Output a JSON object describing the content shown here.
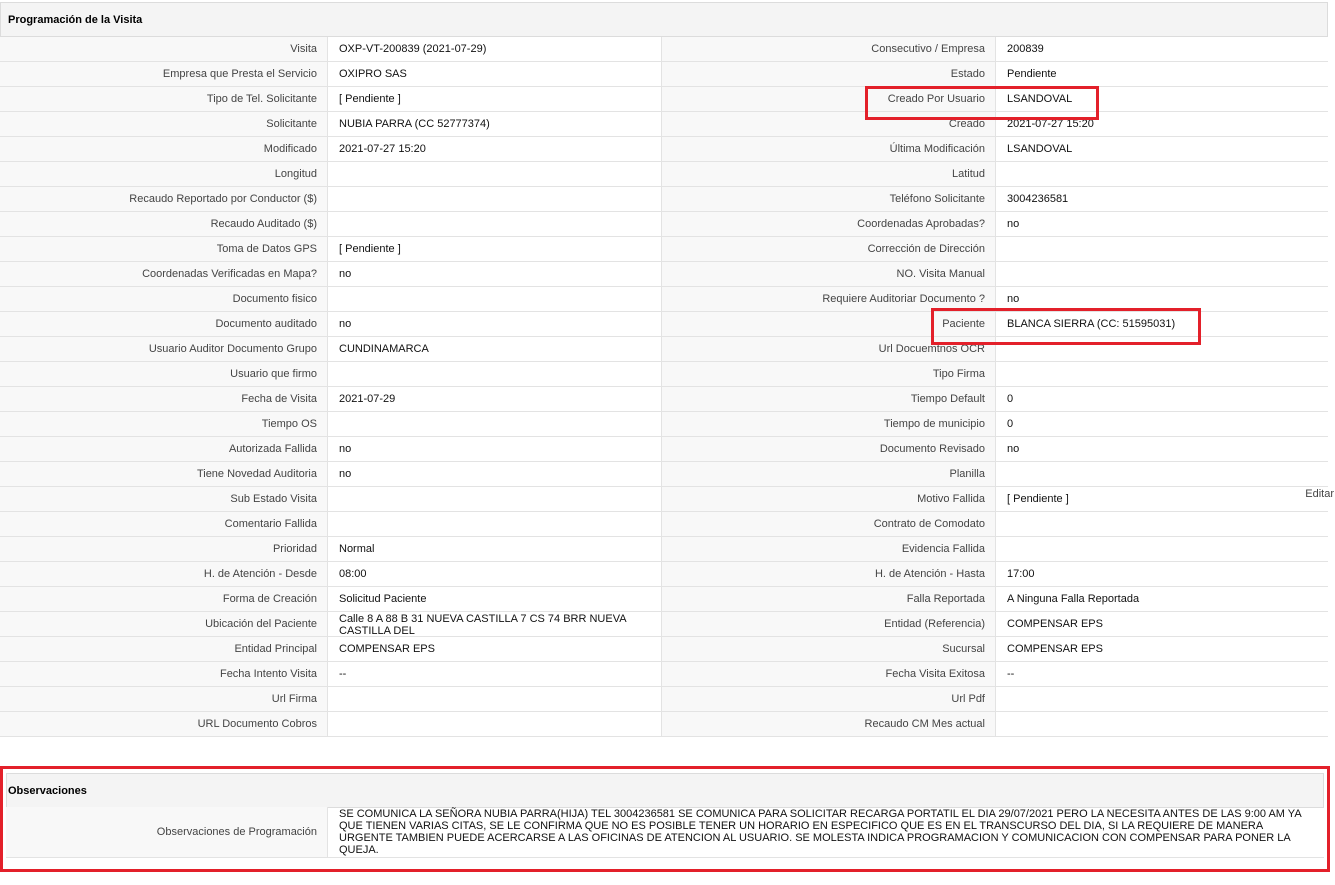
{
  "section_title": "Programación de la Visita",
  "rows": [
    {
      "l1": "Visita",
      "v1": "OXP-VT-200839 (2021-07-29)",
      "l2": "Consecutivo / Empresa",
      "v2": "200839"
    },
    {
      "l1": "Empresa que Presta el Servicio",
      "v1": "OXIPRO SAS",
      "l2": "Estado",
      "v2": "Pendiente"
    },
    {
      "l1": "Tipo de Tel. Solicitante",
      "v1": "[ Pendiente ]",
      "l2": "Creado Por Usuario",
      "v2": "LSANDOVAL"
    },
    {
      "l1": "Solicitante",
      "v1": "NUBIA PARRA (CC 52777374)",
      "l2": "Creado",
      "v2": "2021-07-27 15:20"
    },
    {
      "l1": "Modificado",
      "v1": "2021-07-27 15:20",
      "l2": "Última Modificación",
      "v2": " LSANDOVAL"
    },
    {
      "l1": "Longitud",
      "v1": "",
      "l2": "Latitud",
      "v2": ""
    },
    {
      "l1": "Recaudo Reportado por Conductor ($)",
      "v1": "",
      "l2": "Teléfono Solicitante",
      "v2": "3004236581"
    },
    {
      "l1": "Recaudo Auditado ($)",
      "v1": "",
      "l2": "Coordenadas Aprobadas?",
      "v2": " no"
    },
    {
      "l1": "Toma de Datos GPS",
      "v1": "[ Pendiente ]",
      "l2": "Corrección de Dirección",
      "v2": ""
    },
    {
      "l1": "Coordenadas Verificadas en Mapa?",
      "v1": " no",
      "l2": "NO. Visita Manual",
      "v2": ""
    },
    {
      "l1": "Documento fisico",
      "v1": "",
      "l2": "Requiere Auditoriar Documento ?",
      "v2": " no"
    },
    {
      "l1": "Documento auditado",
      "v1": " no",
      "l2": "Paciente",
      "v2": "BLANCA SIERRA (CC: 51595031)"
    },
    {
      "l1": "Usuario Auditor Documento Grupo",
      "v1": "CUNDINAMARCA",
      "l2": "Url Docuemtnos OCR",
      "v2": ""
    },
    {
      "l1": "Usuario que firmo",
      "v1": "",
      "l2": "Tipo Firma",
      "v2": ""
    },
    {
      "l1": "Fecha de Visita",
      "v1": " 2021-07-29",
      "l2": "Tiempo Default",
      "v2": "0"
    },
    {
      "l1": "Tiempo OS",
      "v1": "",
      "l2": "Tiempo de municipio",
      "v2": "0"
    },
    {
      "l1": "Autorizada Fallida",
      "v1": " no",
      "l2": "Documento Revisado",
      "v2": " no"
    },
    {
      "l1": "Tiene Novedad Auditoria",
      "v1": " no",
      "l2": "Planilla",
      "v2": ""
    },
    {
      "l1": "Sub Estado Visita",
      "v1": "",
      "l2": "Motivo Fallida",
      "v2": "[ Pendiente ]"
    },
    {
      "l1": "Comentario Fallida",
      "v1": "",
      "l2": "Contrato de Comodato",
      "v2": ""
    },
    {
      "l1": "Prioridad",
      "v1": "Normal",
      "l2": "Evidencia Fallida",
      "v2": ""
    },
    {
      "l1": "H. de Atención - Desde",
      "v1": "08:00",
      "l2": "H. de Atención - Hasta",
      "v2": "17:00"
    },
    {
      "l1": "Forma de Creación",
      "v1": "Solicitud Paciente",
      "l2": "Falla Reportada",
      "v2": "A Ninguna Falla Reportada"
    },
    {
      "l1": "Ubicación del Paciente",
      "v1": "Calle 8 A 88 B 31 NUEVA CASTILLA 7 CS 74 BRR NUEVA CASTILLA DEL",
      "l2": "Entidad (Referencia)",
      "v2": "COMPENSAR EPS"
    },
    {
      "l1": "Entidad Principal",
      "v1": "COMPENSAR EPS",
      "l2": "Sucursal",
      "v2": "COMPENSAR EPS"
    },
    {
      "l1": "Fecha Intento Visita",
      "v1": " --",
      "l2": "Fecha Visita Exitosa",
      "v2": " --"
    },
    {
      "l1": "Url Firma",
      "v1": "",
      "l2": "Url Pdf",
      "v2": ""
    },
    {
      "l1": "URL Documento Cobros",
      "v1": "",
      "l2": "Recaudo CM Mes actual",
      "v2": ""
    }
  ],
  "editar_label": "Editar",
  "observaciones": {
    "title": "Observaciones",
    "label": "Observaciones de Programación",
    "text": "  SE COMUNICA LA SEÑORA NUBIA PARRA(HIJA) TEL 3004236581 SE COMUNICA PARA SOLICITAR RECARGA PORTATIL EL DIA 29/07/2021 PERO LA NECESITA ANTES DE LAS 9:00 AM YA QUE TIENEN VARIAS CITAS, SE LE CONFIRMA QUE NO ES POSIBLE TENER UN HORARIO EN ESPECIFICO QUE ES EN EL TRANSCURSO DEL DIA, SI LA REQUIERE DE MANERA URGENTE TAMBIEN PUEDE ACERCARSE A LAS OFICINAS DE ATENCION AL USUARIO. SE MOLESTA INDICA PROGRAMACION Y COMUNICACION CON COMPENSAR PARA PONER LA QUEJA."
  },
  "colors": {
    "highlight": "#e3202a",
    "label_bg": "#f8f8f8",
    "header_bg": "#f4f4f4"
  }
}
